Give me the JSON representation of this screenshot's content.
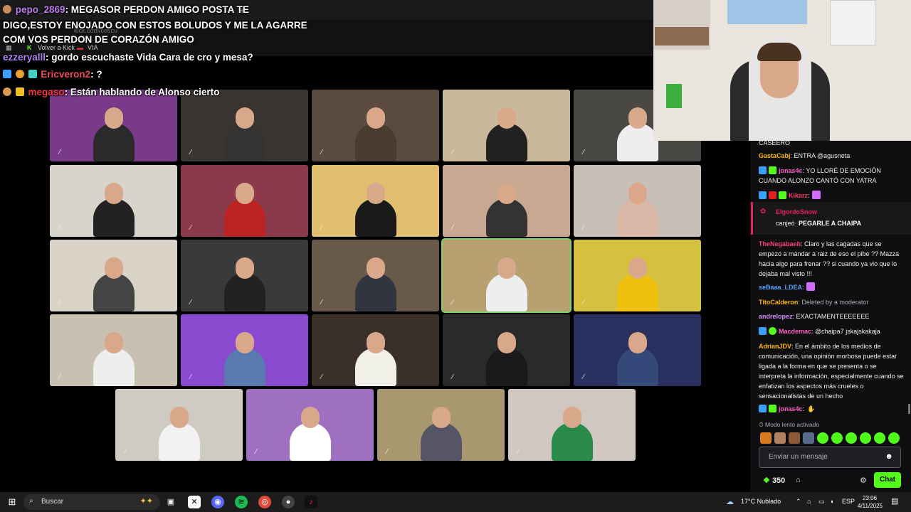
{
  "browser": {
    "address": "kick.com/coscu",
    "bookmarks": [
      "Volver a Kick",
      "VIA"
    ]
  },
  "stream_overlay_chat": [
    {
      "user": "pepo_2869",
      "text": ": MEGASOR PERDON AMIGO POSTA TE",
      "color": "#c07cf0"
    },
    {
      "user": "",
      "text": "DIGO,ESTOY ENOJADO CON ESTOS BOLUDOS Y ME LA AGARRE",
      "color": "#ffffff"
    },
    {
      "user": "",
      "text": "COM VOS PERDON DE CORAZÓN AMIGO",
      "color": "#ffffff"
    },
    {
      "user": "ezzeryalll",
      "text": ": gordo escuchaste Vida Cara de cro y mesa?",
      "color": "#b184f5"
    },
    {
      "user": "Ericveron2",
      "text": ": ?",
      "color": "#ee4a5a"
    },
    {
      "user": "megaso",
      "text": ": Están hablando de Alonso cierto",
      "color": "#ee3a3a"
    }
  ],
  "chat": {
    "messages": [
      {
        "user": "",
        "text": "CASEERO",
        "color": "#efeff1"
      },
      {
        "user": "GastaCabj",
        "text": ": ENTRA @agusneta",
        "color": "#ffb800"
      },
      {
        "user": "jonas4c",
        "text": ": YO LLORÉ DE EMOCIÓN CUANDO ALONZO CANTÓ CON YATRA",
        "color": "#ff5ec4"
      },
      {
        "user": "Kikarz",
        "text": ":",
        "color": "#ff3b6b"
      },
      {
        "user": "TheNegabaeh",
        "text": ": Claro y las cagadas que se empezo a mandar a raiz de eso el pibe ?? Mazza hacia algo para frenar ?? si cuando ya vio que lo dejaba mal visto !!!",
        "color": "#ff3d7f"
      },
      {
        "user": "seBaaa_LDEA",
        "text": ":",
        "color": "#4ea3ff"
      },
      {
        "user": "TitoCalderon",
        "text": ": Deleted by a moderator",
        "color": "#ffb800"
      },
      {
        "user": "andrelopez",
        "text": ": EXACTAMENTEEEEEEE",
        "color": "#d58cff"
      },
      {
        "user": "Macdemac",
        "text": ": @chaipa7 jskajskakaja",
        "color": "#ff5ec4"
      },
      {
        "user": "AdrianJDV",
        "text": ": En el ámbito de los medios de comunicación, una opinión morbosa puede estar ligada a la forma en que se presenta o se interpreta la información, especialmente cuando se enfatizan los aspectos más crueles o sensacionalistas de un hecho",
        "color": "#ffb800"
      },
      {
        "user": "jonas4c",
        "text": ":",
        "color": "#ff5ec4"
      }
    ],
    "redeem": {
      "user": "ElgordoSnow",
      "action": "canjeó",
      "reward": "PEGARLE A CHAIPA"
    },
    "slow_mode": "Modo lento activado",
    "input_placeholder": "Enviar un mensaje",
    "points": "350",
    "send_label": "Chat"
  },
  "taskbar": {
    "search": "Buscar",
    "weather": "17°C  Nublado",
    "lang": "ESP",
    "time": "23:06",
    "date": "4/11/2025"
  },
  "colors": {
    "accent": "#53fc18",
    "chat_bg": "#0e0e10",
    "taskbar_bg": "#1c1c1c"
  }
}
